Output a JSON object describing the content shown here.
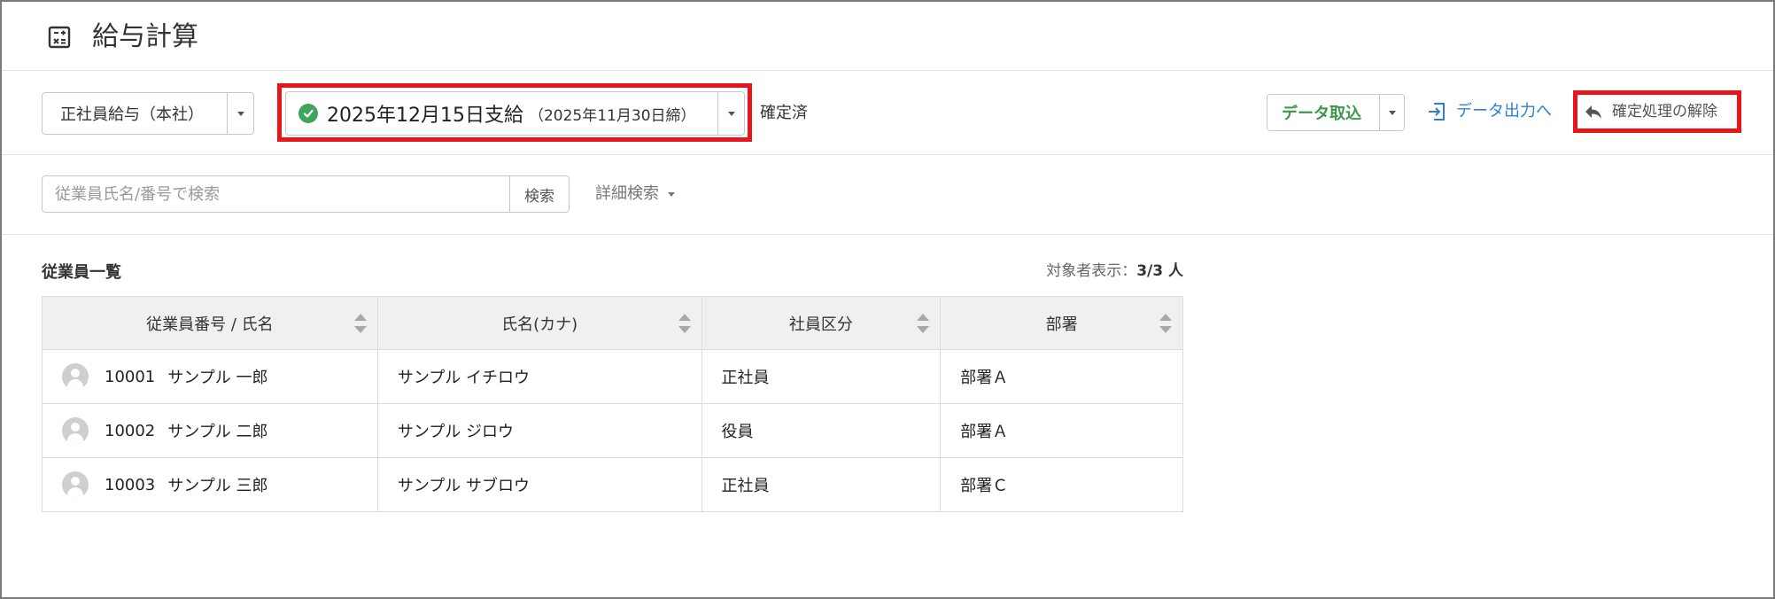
{
  "header": {
    "title": "給与計算",
    "icon": "calculator-icon"
  },
  "toolbar": {
    "company_select": {
      "value": "正社員給与（本社）"
    },
    "payday_select": {
      "main": "2025年12月15日支給",
      "sub": "（2025年11月30日締）",
      "status_icon": "check-circle-icon",
      "status_color": "#3fa45c"
    },
    "status_text": "確定済",
    "import_button": "データ取込",
    "export_link": "データ出力へ",
    "unconfirm_link": "確定処理の解除",
    "highlight_color": "#e8161b"
  },
  "search": {
    "placeholder": "従業員氏名/番号で検索",
    "button": "検索",
    "advanced": "詳細検索"
  },
  "list": {
    "title": "従業員一覧",
    "count_label": "対象者表示：",
    "count_value": "3/3 人",
    "columns": [
      "従業員番号 / 氏名",
      "氏名(カナ)",
      "社員区分",
      "部署"
    ],
    "rows": [
      {
        "no": "10001",
        "name": "サンプル 一郎",
        "kana": "サンプル イチロウ",
        "type": "正社員",
        "dept": "部署Ａ"
      },
      {
        "no": "10002",
        "name": "サンプル 二郎",
        "kana": "サンプル ジロウ",
        "type": "役員",
        "dept": "部署Ａ"
      },
      {
        "no": "10003",
        "name": "サンプル 三郎",
        "kana": "サンプル サブロウ",
        "type": "正社員",
        "dept": "部署Ｃ"
      }
    ]
  }
}
